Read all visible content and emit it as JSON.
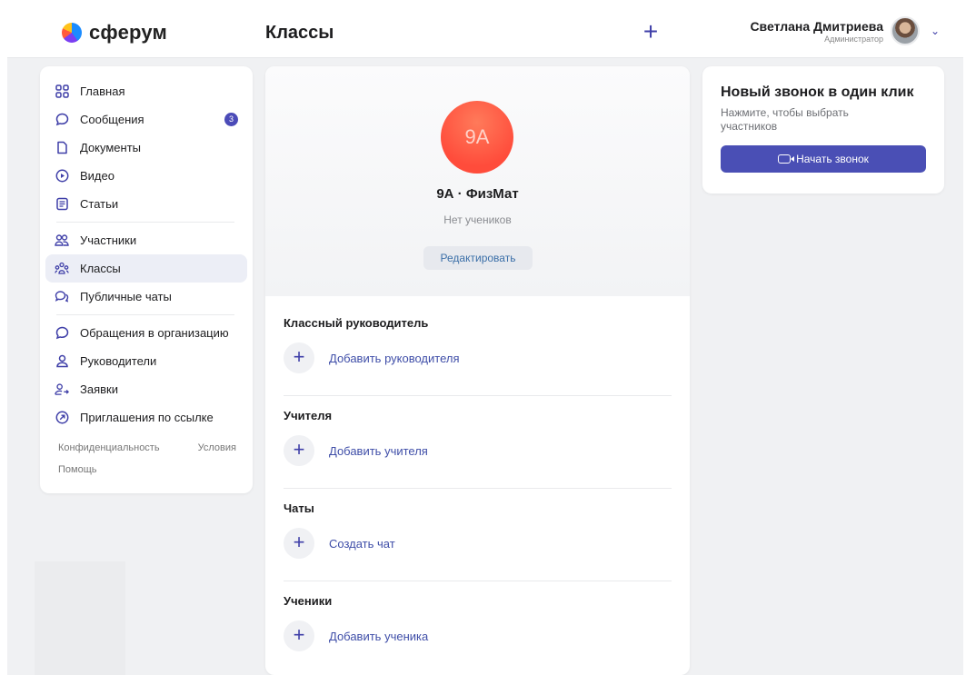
{
  "header": {
    "logo_text": "сферум",
    "page_title": "Классы",
    "add_icon": "plus-icon",
    "user_name": "Светлана Дмитриева",
    "user_role": "Администратор"
  },
  "sidebar": {
    "items": [
      {
        "label": "Главная",
        "icon": "grid-icon"
      },
      {
        "label": "Сообщения",
        "icon": "chat-icon",
        "badge": "3"
      },
      {
        "label": "Документы",
        "icon": "document-icon"
      },
      {
        "label": "Видео",
        "icon": "play-icon"
      },
      {
        "label": "Статьи",
        "icon": "article-icon"
      },
      {
        "label": "Участники",
        "icon": "users-icon"
      },
      {
        "label": "Классы",
        "icon": "classes-icon",
        "active": true
      },
      {
        "label": "Публичные чаты",
        "icon": "public-chat-icon"
      },
      {
        "label": "Обращения в организацию",
        "icon": "chat-icon"
      },
      {
        "label": "Руководители",
        "icon": "person-icon"
      },
      {
        "label": "Заявки",
        "icon": "person-arrow-icon"
      },
      {
        "label": "Приглашения по ссылке",
        "icon": "link-arrow-icon"
      }
    ],
    "footer": {
      "privacy": "Конфиденциальность",
      "terms": "Условия",
      "help": "Помощь"
    }
  },
  "class_card": {
    "avatar_text": "9A",
    "name": "9А · ФизМат",
    "subtitle": "Нет учеников",
    "edit_label": "Редактировать",
    "sections": [
      {
        "title": "Классный руководитель",
        "action": "Добавить руководителя"
      },
      {
        "title": "Учителя",
        "action": "Добавить учителя"
      },
      {
        "title": "Чаты",
        "action": "Создать чат"
      },
      {
        "title": "Ученики",
        "action": "Добавить ученика"
      }
    ]
  },
  "call_card": {
    "title": "Новый звонок в один клик",
    "subtitle": "Нажмите, чтобы выбрать участников",
    "button_label": "Начать звонок"
  },
  "colors": {
    "accent": "#4a4fb5",
    "class_avatar": "#ff4c3b",
    "badge": "#4b4bb8"
  }
}
